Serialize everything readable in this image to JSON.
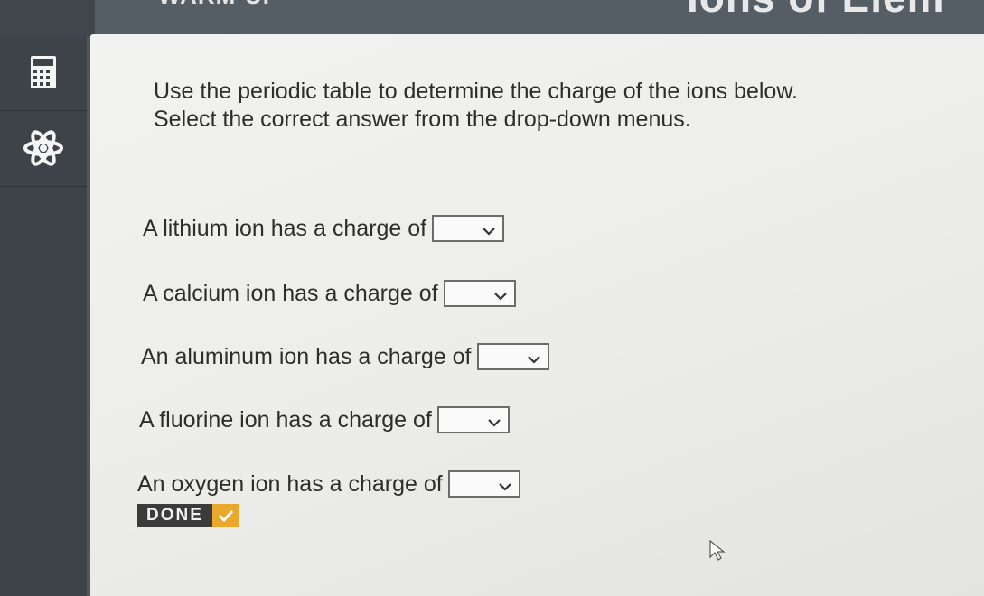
{
  "header": {
    "section_label": "WARM-UP",
    "title": "Ions of Elem"
  },
  "sidebar": {
    "tools": [
      {
        "name": "calculator",
        "icon": "calculator-icon"
      },
      {
        "name": "periodic-table",
        "icon": "atom-icon"
      }
    ]
  },
  "instructions": "Use the periodic table to determine the charge of the ions below. Select the correct answer from the drop-down menus.",
  "questions": [
    {
      "text": "A lithium ion has a charge of",
      "selected": ""
    },
    {
      "text": "A calcium ion has a charge of",
      "selected": ""
    },
    {
      "text": "An aluminum ion has a charge of",
      "selected": ""
    },
    {
      "text": "A fluorine ion has a charge of",
      "selected": ""
    },
    {
      "text": "An oxygen ion has a charge of",
      "selected": ""
    }
  ],
  "done_button": {
    "label": "DONE",
    "icon": "check-icon"
  },
  "colors": {
    "sidebar_bg": "#3d4348",
    "content_bg": "#efefed",
    "done_bg": "#3b3b3b",
    "done_accent": "#e9a72c"
  }
}
